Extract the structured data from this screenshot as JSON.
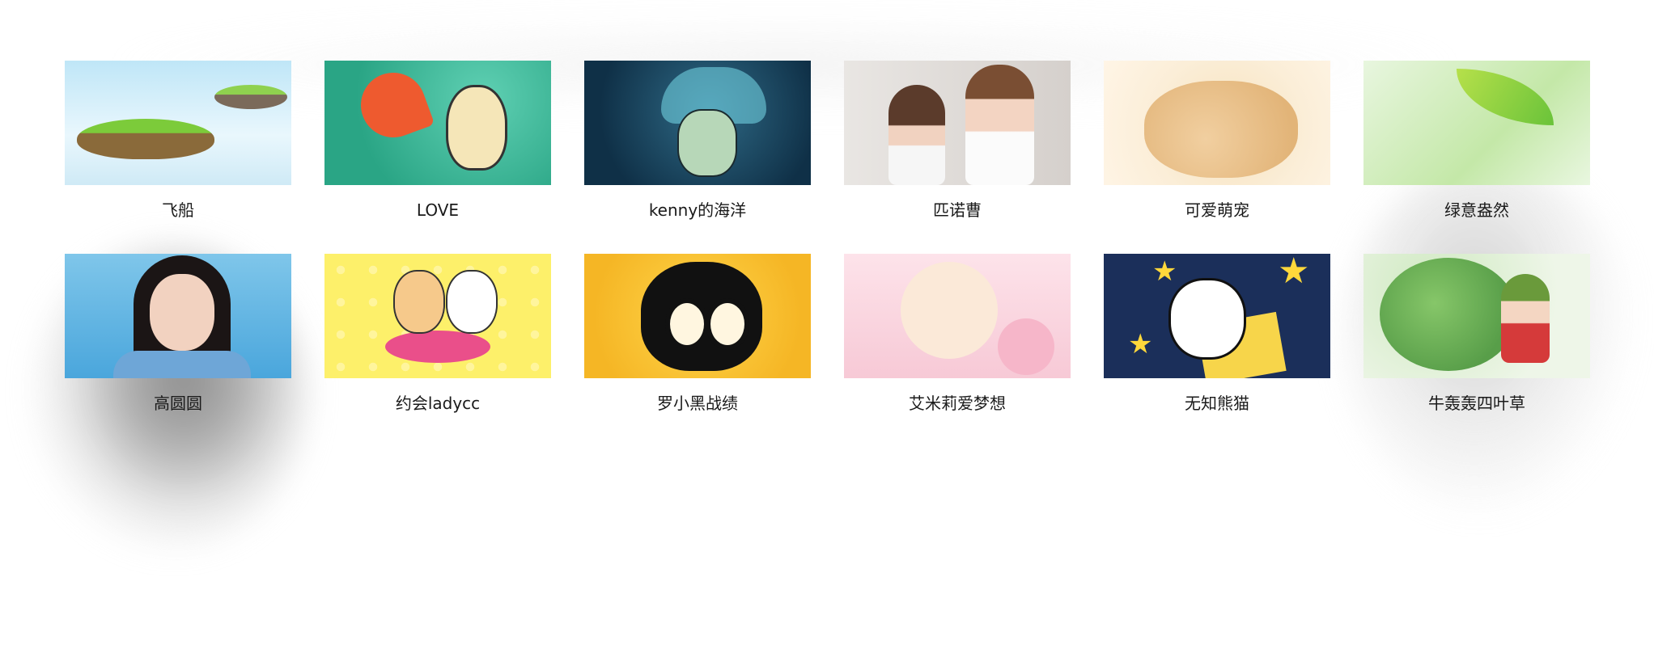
{
  "gallery": {
    "items": [
      {
        "label": "飞船"
      },
      {
        "label": "LOVE"
      },
      {
        "label": "kenny的海洋"
      },
      {
        "label": "匹诺曹"
      },
      {
        "label": "可爱萌宠"
      },
      {
        "label": "绿意盎然"
      },
      {
        "label": "高圆圆"
      },
      {
        "label": "约会ladycc"
      },
      {
        "label": "罗小黑战绩"
      },
      {
        "label": "艾米莉爱梦想"
      },
      {
        "label": "无知熊猫"
      },
      {
        "label": "牛轰轰四叶草"
      }
    ]
  },
  "colors": {
    "background": "#ffffff",
    "label_text": "#1a1a1a"
  }
}
